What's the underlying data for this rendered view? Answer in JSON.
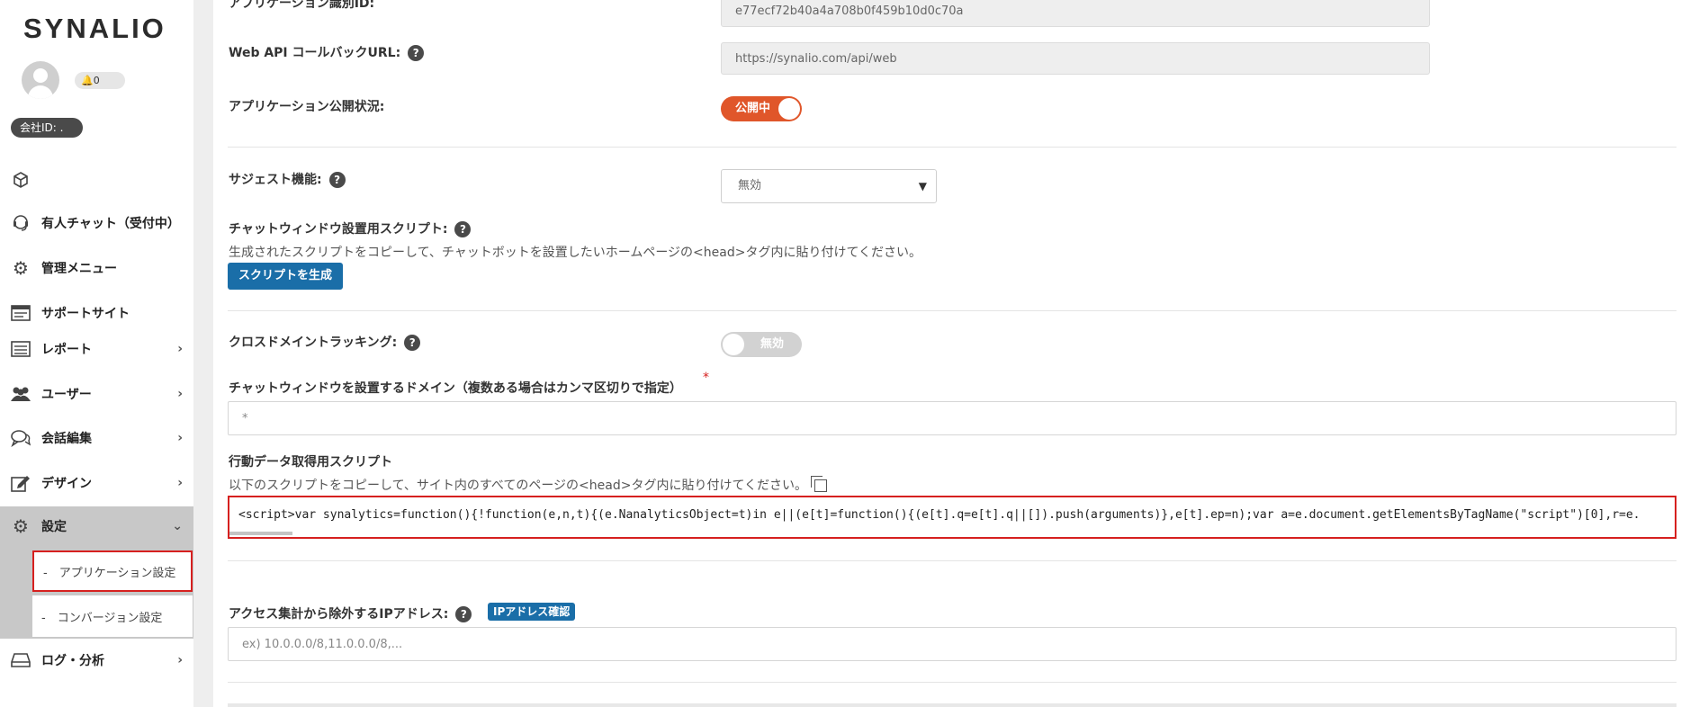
{
  "sidebar": {
    "logo": "SYNALIO",
    "notification_count": "0",
    "company_id_label": "会社ID: .",
    "workspace_label": "",
    "items": [
      {
        "label": "有人チャット（受付中）",
        "icon": "headset-icon"
      },
      {
        "label": "管理メニュー",
        "icon": "gears-icon"
      },
      {
        "label": "サポートサイト",
        "icon": "browser-window-icon"
      },
      {
        "label": "レポート",
        "icon": "list-report-icon",
        "chevron": "›"
      },
      {
        "label": "ユーザー",
        "icon": "users-icon",
        "chevron": "›"
      },
      {
        "label": "会話編集",
        "icon": "chat-bubbles-icon",
        "chevron": "›"
      },
      {
        "label": "デザイン",
        "icon": "edit-icon",
        "chevron": "›"
      },
      {
        "label": "設定",
        "icon": "gears-icon",
        "chevron": "⌄"
      },
      {
        "label": "ログ・分析",
        "icon": "drive-icon",
        "chevron": "›"
      }
    ],
    "sub_items": [
      {
        "label": "-　アプリケーション設定"
      },
      {
        "label": "-　コンバージョン設定"
      }
    ]
  },
  "form": {
    "app_id": {
      "label": "アプリケーション識別ID:",
      "value": "e77ecf72b40a4a708b0f459b10d0c70a"
    },
    "callback_url": {
      "label": "Web API コールバックURL:",
      "value": "https://synalio.com/api/web"
    },
    "publish_status": {
      "label": "アプリケーション公開状況:",
      "toggle_text": "公開中"
    },
    "suggest": {
      "label": "サジェスト機能:",
      "selected": "無効",
      "arrow": "▼"
    },
    "chat_script": {
      "label": "チャットウィンドウ設置用スクリプト:",
      "description": "生成されたスクリプトをコピーして、チャットボットを設置したいホームページの<head>タグ内に貼り付けてください。",
      "button": "スクリプトを生成"
    },
    "cross_domain": {
      "label": "クロスドメイントラッキング:",
      "toggle_text": "無効"
    },
    "domain": {
      "label": "チャットウィンドウを設置するドメイン（複数ある場合はカンマ区切りで指定）",
      "required": "*",
      "value": "*"
    },
    "behavior_script": {
      "label": "行動データ取得用スクリプト",
      "description": "以下のスクリプトをコピーして、サイト内のすべてのページの<head>タグ内に貼り付けてください。",
      "code": "<script>var synalytics=function(){!function(e,n,t){(e.NanalyticsObject=t)in e||(e[t]=function(){(e[t].q=e[t].q||[]).push(arguments)},e[t].ep=n);var a=e.document.getElementsByTagName(\"script\")[0],r=e."
    },
    "ip_exclude": {
      "label": "アクセス集計から除外するIPアドレス:",
      "badge": "IPアドレス確認",
      "placeholder": "ex) 10.0.0.0/8,11.0.0.0/8,..."
    }
  },
  "help_glyph": "?",
  "colors": {
    "accent_orange": "#e0562a",
    "primary_blue": "#1a6ea8",
    "highlight_red": "#d6201f"
  }
}
